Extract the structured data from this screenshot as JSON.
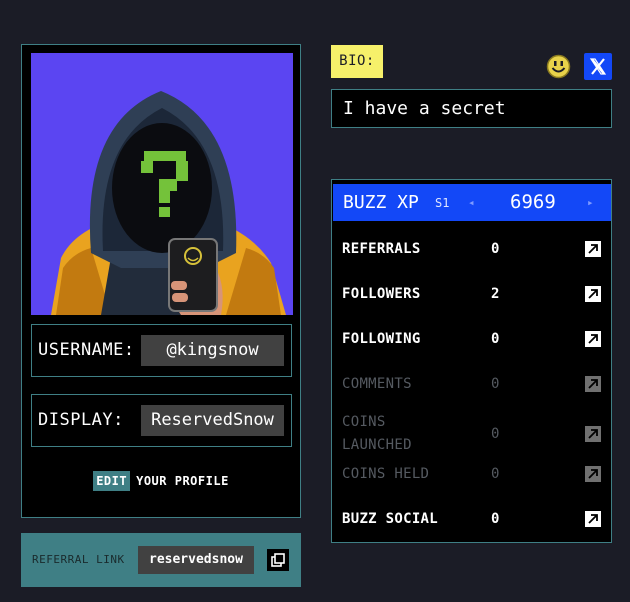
{
  "profile": {
    "username_label": "USERNAME:",
    "username": "@kingsnow",
    "display_label": "DISPLAY:",
    "display_name": "ReservedSnow",
    "edit_label": "EDIT",
    "edit_suffix": "YOUR PROFILE"
  },
  "referral": {
    "label": "REFERRAL LINK",
    "value": "reservedsnow"
  },
  "bio": {
    "label": "BIO:",
    "text": "I have a secret"
  },
  "xp": {
    "label": "BUZZ XP",
    "season": "S1",
    "value": "6969",
    "prev": "◂",
    "next": "▸"
  },
  "stats": [
    {
      "label": "REFERRALS",
      "value": "0",
      "enabled": true
    },
    {
      "label": "FOLLOWERS",
      "value": "2",
      "enabled": true
    },
    {
      "label": "FOLLOWING",
      "value": "0",
      "enabled": true
    },
    {
      "label": "COMMENTS",
      "value": "0",
      "enabled": false
    },
    {
      "label": "COINS\nLAUNCHED",
      "value": "0",
      "enabled": false
    },
    {
      "label": "COINS HELD",
      "value": "0",
      "enabled": false
    },
    {
      "label": "BUZZ SOCIAL",
      "value": "0",
      "enabled": true
    }
  ],
  "colors": {
    "background": "#1b1c26",
    "accent_teal": "#3f7f85",
    "accent_blue": "#1348f7",
    "bio_yellow": "#f6f06a",
    "avatar_bg": "#5b45f2"
  },
  "icons": {
    "smiley": "smiley-icon",
    "x_logo": "x-logo-icon",
    "copy": "copy-icon",
    "external_link": "external-link-icon"
  }
}
